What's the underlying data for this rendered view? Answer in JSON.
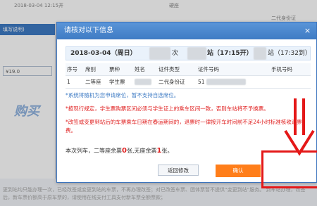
{
  "background": {
    "top_date": "2018-03-04 12:15开",
    "top_seat": "硬座",
    "row2_id_type": "二代身份证",
    "left_header": "填写说明)",
    "left_price": "¥19.0",
    "left_big": "购买",
    "footer_text": "更到站均只能办理一次，已经改签或变更到站的车票，不再办理改签；对已改签车票、团体票暂不提供“变更到站”服务。 到车站办理，改签后，新车票价额高于原车票的，请使用在线支付工具支付新车票全额票款；"
  },
  "dialog": {
    "title": "请核对以下信息",
    "close_label": "×",
    "train_date": "2018-03-04（周日）",
    "train_suffix": "次",
    "depart": "站（17:15开）",
    "arrive": "站（17:32到）",
    "table": {
      "headers": [
        "序号",
        "席别",
        "票种",
        "姓名",
        "证件类型",
        "证件号码",
        "手机号码"
      ],
      "rows": [
        [
          "1",
          "二等座",
          "学生票",
          "",
          "二代身份证",
          "51",
          ""
        ]
      ]
    },
    "notes": {
      "seat_note": "*系统将随机为您申请席位，暂不支持自选席位。",
      "rule_note": "*按现行规定，学生票购票区间必须与学生证上的乘车区间一致，否则车站将不予换票。",
      "refund_note": "*改签或变更到站后的车票乘车日期在春运期间的，退票时一律按开车时间前不足24小时标准核收退票费。"
    },
    "remain": {
      "prefix": "本次列车，二等座余票",
      "second_count": "0",
      "mid": "张,无座余票",
      "standing_count": "1",
      "suffix": "张。"
    },
    "buttons": {
      "back": "返回修改",
      "confirm": "确认"
    }
  },
  "colors": {
    "header_blue": "#3e7bc4",
    "confirm_orange": "#ff7e1a",
    "annotation_red": "#e41818"
  }
}
